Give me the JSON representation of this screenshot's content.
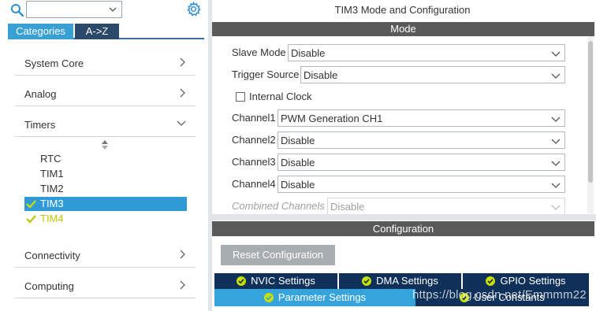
{
  "left": {
    "search": {
      "value": "",
      "placeholder": ""
    },
    "tabs": [
      {
        "label": "Categories",
        "active": true
      },
      {
        "label": "A->Z",
        "active": false
      }
    ],
    "categories": [
      {
        "label": "System Core",
        "expanded": false
      },
      {
        "label": "Analog",
        "expanded": false
      },
      {
        "label": "Timers",
        "expanded": true
      },
      {
        "label": "Connectivity",
        "expanded": false
      },
      {
        "label": "Computing",
        "expanded": false
      }
    ],
    "timers": [
      {
        "label": "RTC",
        "status": "none"
      },
      {
        "label": "TIM1",
        "status": "none"
      },
      {
        "label": "TIM2",
        "status": "none"
      },
      {
        "label": "TIM3",
        "status": "ok",
        "selected": true
      },
      {
        "label": "TIM4",
        "status": "warning"
      }
    ]
  },
  "right": {
    "title": "TIM3 Mode and Configuration",
    "mode": {
      "heading": "Mode",
      "slave_mode": {
        "label": "Slave Mode",
        "value": "Disable"
      },
      "trigger_source": {
        "label": "Trigger Source",
        "value": "Disable"
      },
      "internal_clock": {
        "label": "Internal Clock",
        "checked": false
      },
      "channel1": {
        "label": "Channel1",
        "value": "PWM Generation CH1"
      },
      "channel2": {
        "label": "Channel2",
        "value": "Disable"
      },
      "channel3": {
        "label": "Channel3",
        "value": "Disable"
      },
      "channel4": {
        "label": "Channel4",
        "value": "Disable"
      },
      "combined_channels": {
        "label": "Combined Channels",
        "value": "Disable",
        "disabled": true
      }
    },
    "configuration": {
      "heading": "Configuration",
      "reset_label": "Reset Configuration",
      "tabs": [
        {
          "label": "NVIC Settings"
        },
        {
          "label": "DMA Settings"
        },
        {
          "label": "GPIO Settings"
        },
        {
          "label": "Parameter Settings",
          "active": true
        },
        {
          "label": "User Constants"
        }
      ]
    },
    "watermark": "https://blog.csdn.net/Emmmm22"
  },
  "colors": {
    "accent": "#36a4dc",
    "dark_tab": "#0f3059",
    "section_bar": "#5a5a5a",
    "ok_check": "#c8e000",
    "warning_text": "#c2c400"
  }
}
